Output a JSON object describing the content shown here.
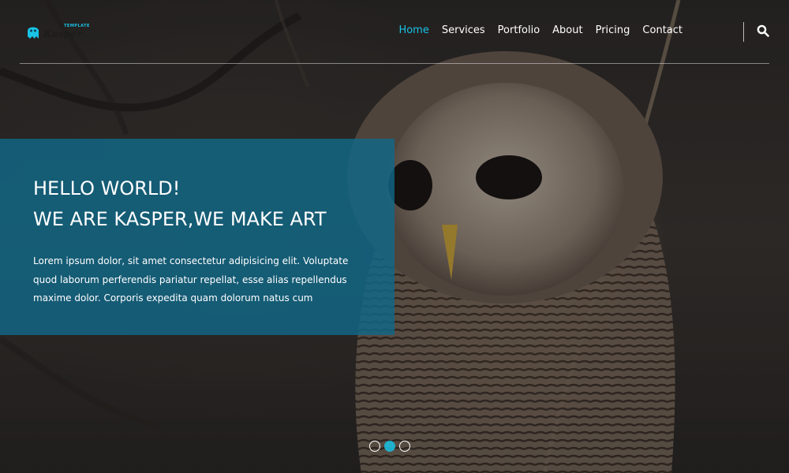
{
  "logo": {
    "word": "Kasper",
    "tag": "TEMPLATE",
    "icon": "ghost-icon"
  },
  "nav": {
    "items": [
      {
        "label": "Home",
        "active": true
      },
      {
        "label": "Services",
        "active": false
      },
      {
        "label": "Portfolio",
        "active": false
      },
      {
        "label": "About",
        "active": false
      },
      {
        "label": "Pricing",
        "active": false
      },
      {
        "label": "Contact",
        "active": false
      }
    ],
    "search_icon": "search-icon"
  },
  "hero": {
    "heading_line1": "HELLO WORLD!",
    "heading_line2": "WE ARE KASPER,WE MAKE ART",
    "paragraph": "Lorem ipsum dolor, sit amet consectetur adipisicing elit. Voluptate quod laborum perferendis pariatur repellat, esse alias repellendus maxime dolor. Corporis expedita quam dolorum natus cum",
    "background_subject": "owl"
  },
  "slider": {
    "bullet_count": 3,
    "active_index": 1
  },
  "colors": {
    "accent": "#19c3e6",
    "panel": "#116888",
    "text": "#ffffff"
  }
}
